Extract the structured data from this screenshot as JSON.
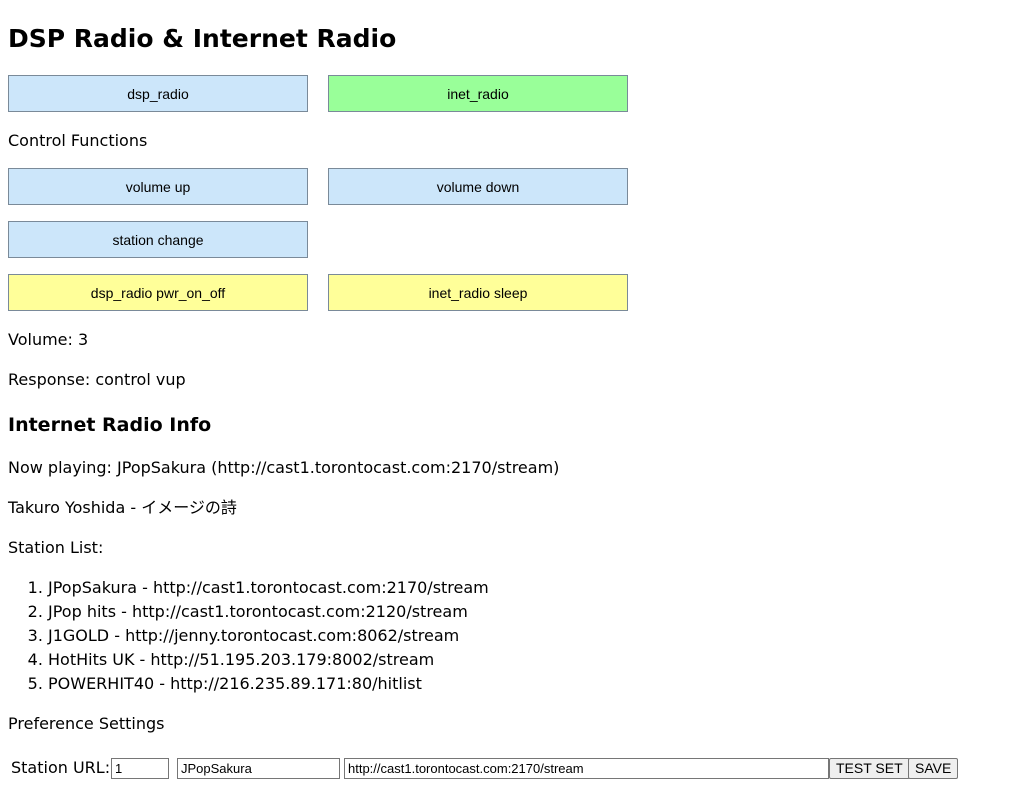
{
  "page": {
    "title": "DSP Radio & Internet Radio"
  },
  "mode_buttons": {
    "dsp_radio": "dsp_radio",
    "inet_radio": "inet_radio"
  },
  "control": {
    "heading": "Control Functions",
    "volume_up": "volume up",
    "volume_down": "volume down",
    "station_change": "station change",
    "dsp_power": "dsp_radio pwr_on_off",
    "inet_sleep": "inet_radio sleep"
  },
  "status": {
    "volume": "Volume: 3",
    "response": "Response: control vup"
  },
  "inet_info": {
    "heading": "Internet Radio Info",
    "now_playing": "Now playing: JPopSakura (http://cast1.torontocast.com:2170/stream)",
    "track": "Takuro Yoshida - イメージの詩",
    "station_list_label": "Station List:",
    "stations": [
      "JPopSakura - http://cast1.torontocast.com:2170/stream",
      "JPop hits - http://cast1.torontocast.com:2120/stream",
      "J1GOLD - http://jenny.torontocast.com:8062/stream",
      "HotHits UK - http://51.195.203.179:8002/stream",
      "POWERHIT40 - http://216.235.89.171:80/hitlist"
    ]
  },
  "preferences": {
    "heading": "Preference Settings",
    "station_url_label": "Station URL:",
    "index_value": "1",
    "name_value": "JPopSakura",
    "url_value": "http://cast1.torontocast.com:2170/stream",
    "test_set_label": "TEST SET",
    "save_label": "SAVE"
  },
  "colors": {
    "button_blue": "#cce6fa",
    "button_green": "#99ff99",
    "button_yellow": "#ffff99"
  }
}
